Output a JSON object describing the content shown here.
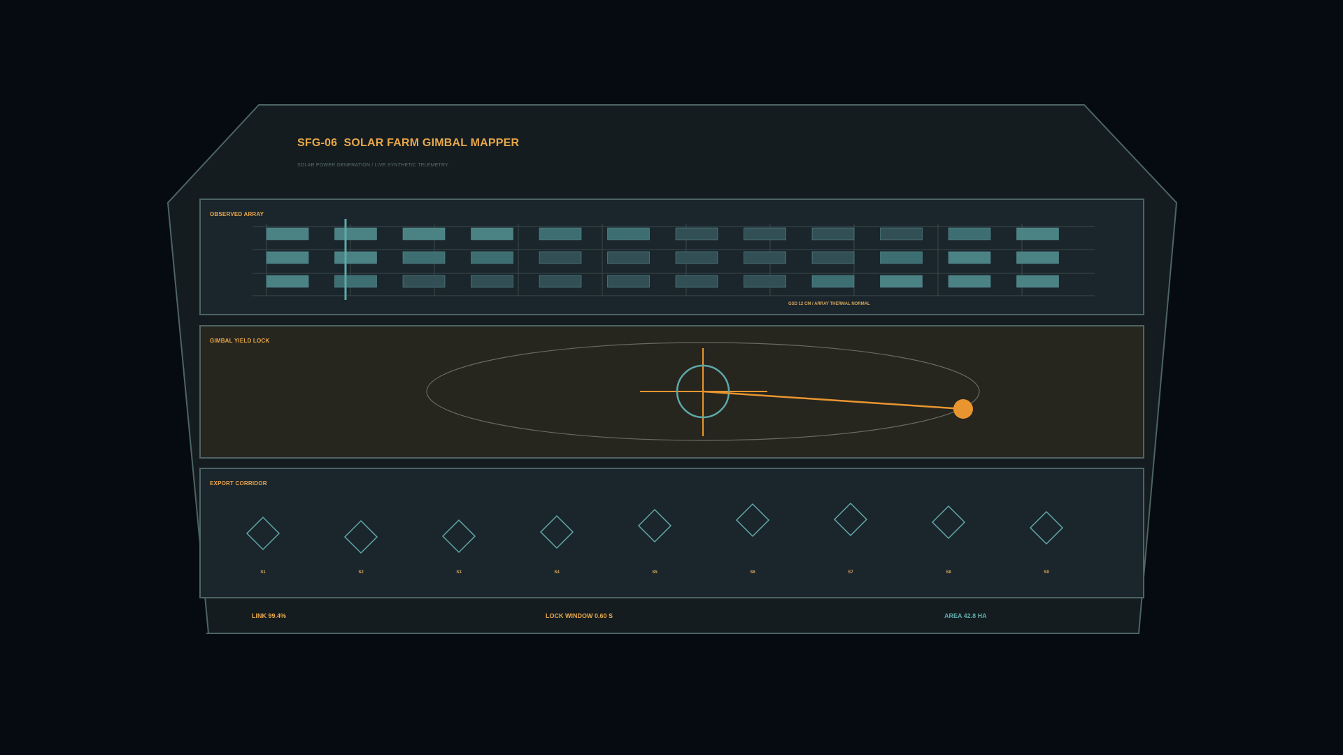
{
  "header": {
    "title": "SFG-06  SOLAR FARM GIMBAL MAPPER",
    "subtitle": "SOLAR POWER GENERATION / LIVE SYNTHETIC TELEMETRY"
  },
  "observed_array": {
    "label": "OBSERVED ARRAY",
    "caption": "GSD 12 CM / ARRAY THERMAL NORMAL"
  },
  "gimbal": {
    "label": "GIMBAL YIELD LOCK"
  },
  "export_corridor": {
    "label": "EXPORT CORRIDOR",
    "stations": [
      "S1",
      "S2",
      "S3",
      "S4",
      "S5",
      "S6",
      "S7",
      "S8",
      "S9"
    ]
  },
  "footer": {
    "link": "LINK 99.4%",
    "lock_window": "LOCK WINDOW 0.60 S",
    "area": "AREA 42.8 HA"
  },
  "colors": {
    "accent_orange": "#e8a74a",
    "accent_teal": "#5fa8a8",
    "border": "#4d6464",
    "background": "#060b12"
  }
}
